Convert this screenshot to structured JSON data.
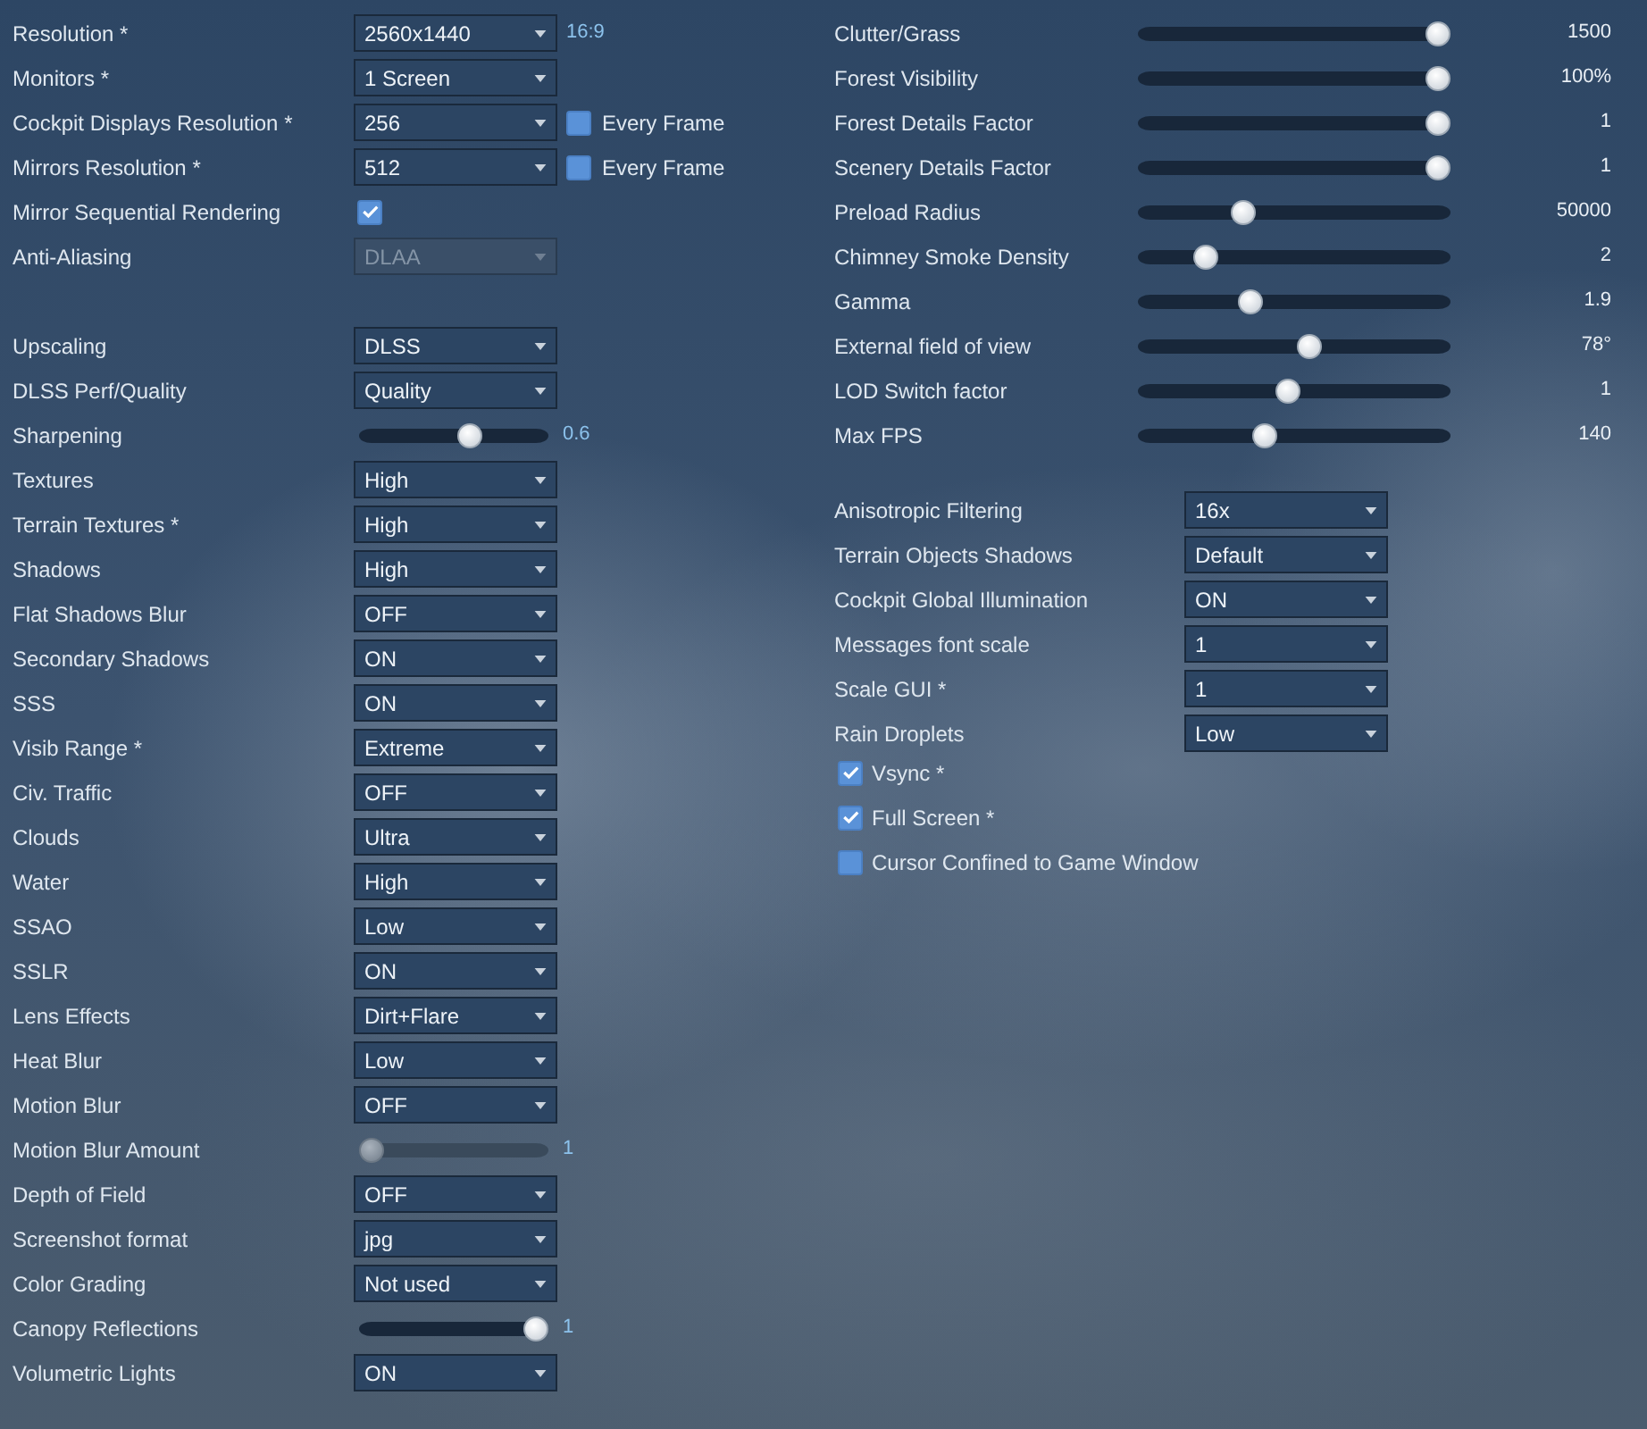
{
  "left_groups": [
    [
      {
        "kind": "dropdown",
        "label": "Resolution *",
        "value": "2560x1440",
        "disabled": false,
        "aspect_ratio": "16:9"
      },
      {
        "kind": "dropdown",
        "label": "Monitors *",
        "value": "1 Screen",
        "disabled": false
      },
      {
        "kind": "dropdown",
        "label": "Cockpit Displays Resolution *",
        "value": "256",
        "disabled": false,
        "option": {
          "label": "Every Frame",
          "checked": false
        }
      },
      {
        "kind": "dropdown",
        "label": "Mirrors Resolution *",
        "value": "512",
        "disabled": false,
        "option": {
          "label": "Every Frame",
          "checked": false
        }
      },
      {
        "kind": "checkbox",
        "label": "Mirror Sequential Rendering",
        "checked": true
      },
      {
        "kind": "dropdown",
        "label": "Anti-Aliasing",
        "value": "DLAA",
        "disabled": true
      }
    ],
    [
      {
        "kind": "dropdown",
        "label": "Upscaling",
        "value": "DLSS",
        "disabled": false
      },
      {
        "kind": "dropdown",
        "label": "DLSS Perf/Quality",
        "value": "Quality",
        "disabled": false
      },
      {
        "kind": "slider",
        "label": "Sharpening",
        "level": 0.6,
        "reading": "0.6",
        "disabled": false
      },
      {
        "kind": "dropdown",
        "label": "Textures",
        "value": "High",
        "disabled": false
      },
      {
        "kind": "dropdown",
        "label": "Terrain Textures *",
        "value": "High",
        "disabled": false
      },
      {
        "kind": "dropdown",
        "label": "Shadows",
        "value": "High",
        "disabled": false
      },
      {
        "kind": "dropdown",
        "label": "Flat Shadows Blur",
        "value": "OFF",
        "disabled": false
      },
      {
        "kind": "dropdown",
        "label": "Secondary Shadows",
        "value": "ON",
        "disabled": false
      },
      {
        "kind": "dropdown",
        "label": "SSS",
        "value": "ON",
        "disabled": false
      },
      {
        "kind": "dropdown",
        "label": "Visib Range *",
        "value": "Extreme",
        "disabled": false
      },
      {
        "kind": "dropdown",
        "label": "Civ. Traffic",
        "value": "OFF",
        "disabled": false
      },
      {
        "kind": "dropdown",
        "label": "Clouds",
        "value": "Ultra",
        "disabled": false
      },
      {
        "kind": "dropdown",
        "label": "Water",
        "value": "High",
        "disabled": false
      },
      {
        "kind": "dropdown",
        "label": "SSAO",
        "value": "Low",
        "disabled": false
      },
      {
        "kind": "dropdown",
        "label": "SSLR",
        "value": "ON",
        "disabled": false
      },
      {
        "kind": "dropdown",
        "label": "Lens Effects",
        "value": "Dirt+Flare",
        "disabled": false
      },
      {
        "kind": "dropdown",
        "label": "Heat Blur",
        "value": "Low",
        "disabled": false
      },
      {
        "kind": "dropdown",
        "label": "Motion Blur",
        "value": "OFF",
        "disabled": false
      },
      {
        "kind": "slider",
        "label": "Motion Blur Amount",
        "level": 0,
        "reading": "1",
        "disabled": true
      },
      {
        "kind": "dropdown",
        "label": "Depth of Field",
        "value": "OFF",
        "disabled": false
      },
      {
        "kind": "dropdown",
        "label": "Screenshot format",
        "value": "jpg",
        "disabled": false
      },
      {
        "kind": "dropdown",
        "label": "Color Grading",
        "value": "Not used",
        "disabled": false
      },
      {
        "kind": "slider",
        "label": "Canopy Reflections",
        "level": 1,
        "reading": "1",
        "disabled": false
      },
      {
        "kind": "dropdown",
        "label": "Volumetric Lights",
        "value": "ON",
        "disabled": false
      }
    ]
  ],
  "right_sliders": [
    {
      "label": "Clutter/Grass",
      "level": 1,
      "reading": "1500"
    },
    {
      "label": "Forest Visibility",
      "level": 1,
      "reading": "100%"
    },
    {
      "label": "Forest Details Factor",
      "level": 1,
      "reading": "1"
    },
    {
      "label": "Scenery Details Factor",
      "level": 1,
      "reading": "1"
    },
    {
      "label": "Preload Radius",
      "level": 0.32,
      "reading": "50000"
    },
    {
      "label": "Chimney Smoke Density",
      "level": 0.19,
      "reading": "2"
    },
    {
      "label": "Gamma",
      "level": 0.35,
      "reading": "1.9"
    },
    {
      "label": "External field of view",
      "level": 0.55,
      "reading": "78°"
    },
    {
      "label": "LOD Switch factor",
      "level": 0.48,
      "reading": "1"
    },
    {
      "label": "Max FPS",
      "level": 0.4,
      "reading": "140"
    }
  ],
  "right_dropdowns": [
    {
      "label": "Anisotropic Filtering",
      "value": "16x"
    },
    {
      "label": "Terrain Objects Shadows",
      "value": "Default"
    },
    {
      "label": "Cockpit Global Illumination",
      "value": "ON"
    },
    {
      "label": "Messages font scale",
      "value": "1"
    },
    {
      "label": "Scale GUI *",
      "value": "1"
    },
    {
      "label": "Rain Droplets",
      "value": "Low"
    }
  ],
  "right_checkboxes": [
    {
      "label": "Vsync *",
      "checked": true
    },
    {
      "label": "Full Screen *",
      "checked": true
    },
    {
      "label": "Cursor Confined to Game Window",
      "checked": false
    }
  ]
}
